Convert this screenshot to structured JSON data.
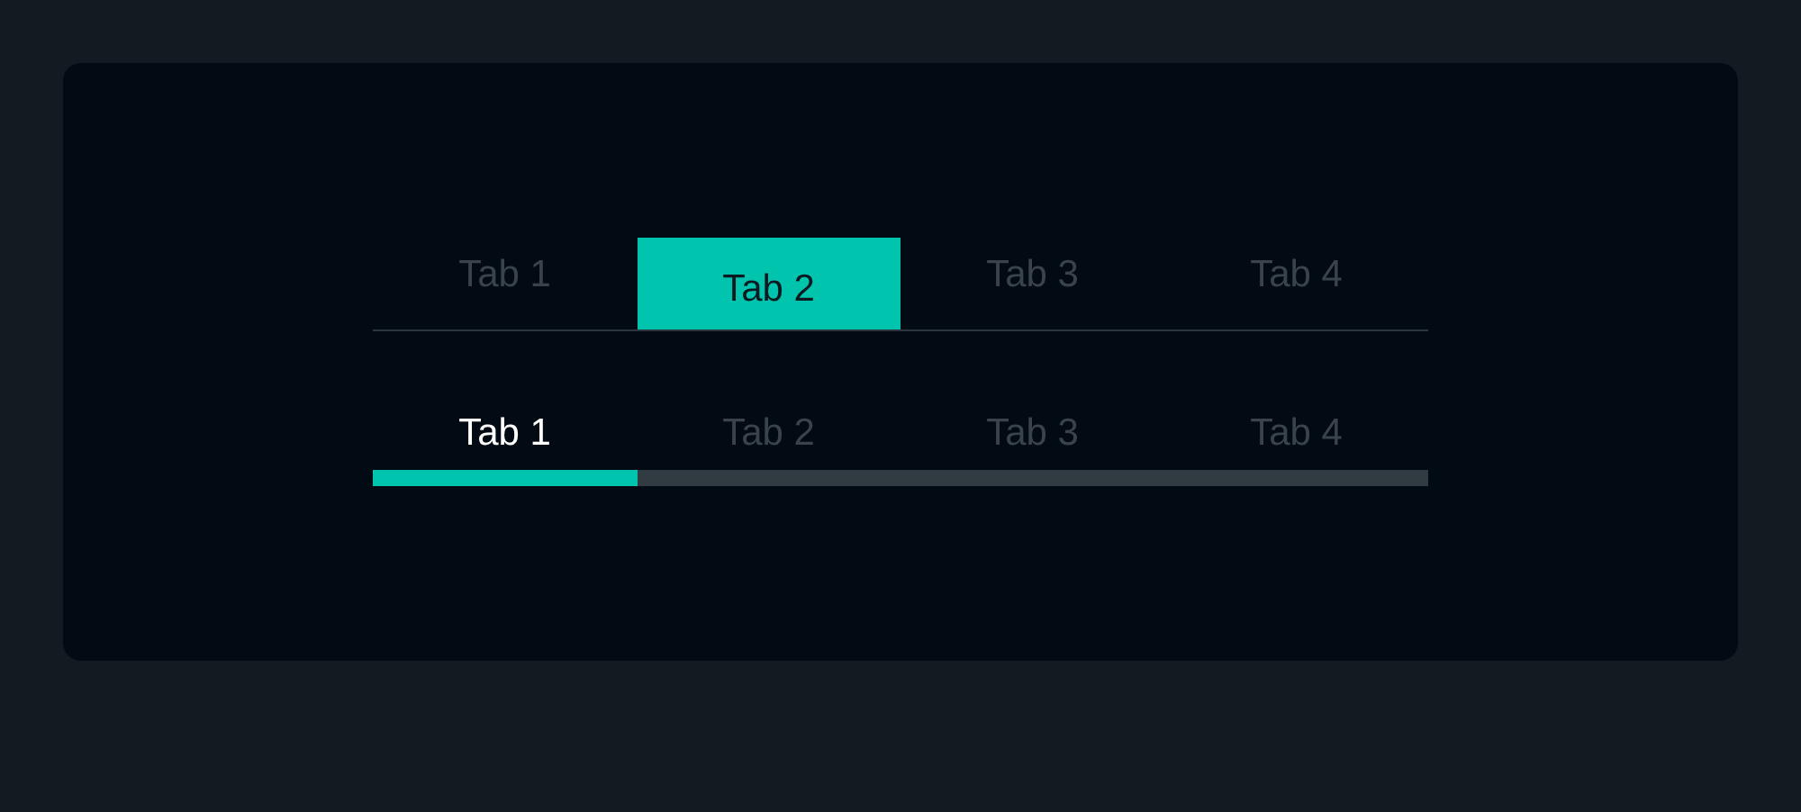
{
  "tab_bars": [
    {
      "kind": "filled",
      "tabs": [
        {
          "label": "Tab 1",
          "selected": false
        },
        {
          "label": "Tab 2",
          "selected": true
        },
        {
          "label": "Tab 3",
          "selected": false
        },
        {
          "label": "Tab 4",
          "selected": false
        }
      ]
    },
    {
      "kind": "underline",
      "tabs": [
        {
          "label": "Tab 1",
          "selected": true
        },
        {
          "label": "Tab 2",
          "selected": false
        },
        {
          "label": "Tab 3",
          "selected": false
        },
        {
          "label": "Tab 4",
          "selected": false
        }
      ]
    }
  ]
}
